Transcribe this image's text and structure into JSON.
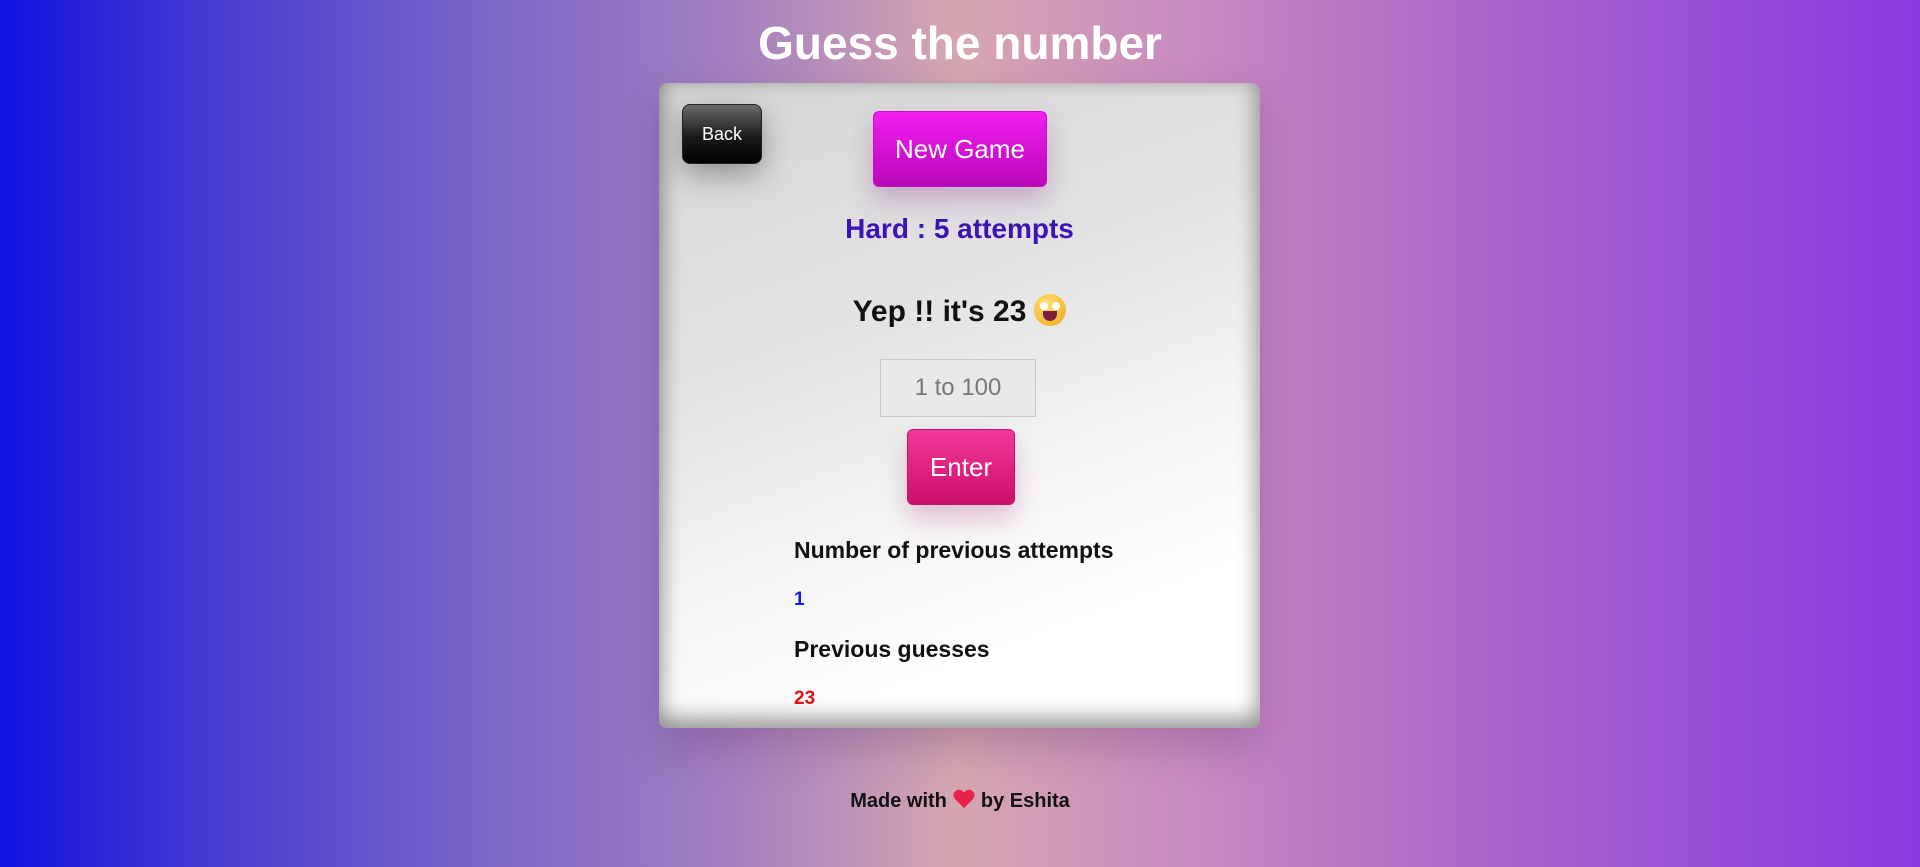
{
  "page": {
    "title": "Guess the number"
  },
  "game": {
    "back_label": "Back",
    "new_game_label": "New Game",
    "difficulty_text": "Hard : 5 attempts",
    "message_text": "Yep !! it's 23",
    "message_emoji": "grinning-face-emoji",
    "input": {
      "placeholder": "1 to 100",
      "value": ""
    },
    "enter_label": "Enter",
    "attempts_label": "Number of previous attempts",
    "attempts_count": "1",
    "guesses_label": "Previous guesses",
    "guesses_value": "23"
  },
  "footer": {
    "prefix": "Made with",
    "icon": "heart-icon",
    "suffix": "by Eshita"
  },
  "colors": {
    "new_game": "#e014e0",
    "enter": "#e0207f",
    "difficulty": "#3b14b8",
    "attempts_count": "#1a1ae6",
    "guesses": "#e01010"
  }
}
